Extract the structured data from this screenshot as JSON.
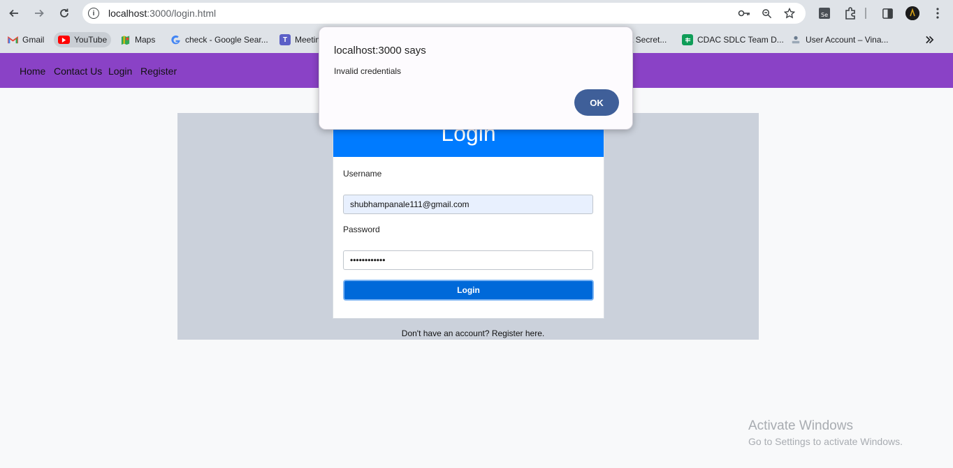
{
  "browser": {
    "url_host": "localhost",
    "url_path": ":3000/login.html",
    "bookmarks": [
      {
        "label": "Gmail",
        "icon": "gmail-icon",
        "color": "#ea4335"
      },
      {
        "label": "YouTube",
        "icon": "youtube-icon",
        "color": "#ff0000"
      },
      {
        "label": "Maps",
        "icon": "maps-icon",
        "color": "#34a853"
      },
      {
        "label": "check - Google Sear...",
        "icon": "google-icon",
        "color": "#4285f4"
      },
      {
        "label": "Meetin",
        "icon": "teams-icon",
        "color": "#5b5fc7"
      },
      {
        "label": "t Secret...",
        "icon": "",
        "color": ""
      },
      {
        "label": "CDAC SDLC Team D...",
        "icon": "sheets-icon",
        "color": "#0f9d58"
      },
      {
        "label": "User Account – Vina...",
        "icon": "account-icon",
        "color": "#6b7c8f"
      }
    ]
  },
  "nav": {
    "home": "Home",
    "contact": "Contact Us",
    "login": "Login",
    "register": "Register",
    "bg_color": "#8a42c6"
  },
  "form": {
    "title": "Login",
    "username_label": "Username",
    "username_value": "shubhampanale111@gmail.com",
    "password_label": "Password",
    "password_value": "••••••••••••",
    "submit_label": "Login",
    "register_text": "Don't have an account? Register here.",
    "header_color": "#007bff",
    "button_color": "#0069d9"
  },
  "dialog": {
    "title": "localhost:3000 says",
    "message": "Invalid credentials",
    "ok_label": "OK"
  },
  "watermark": {
    "line1": "Activate Windows",
    "line2": "Go to Settings to activate Windows."
  }
}
